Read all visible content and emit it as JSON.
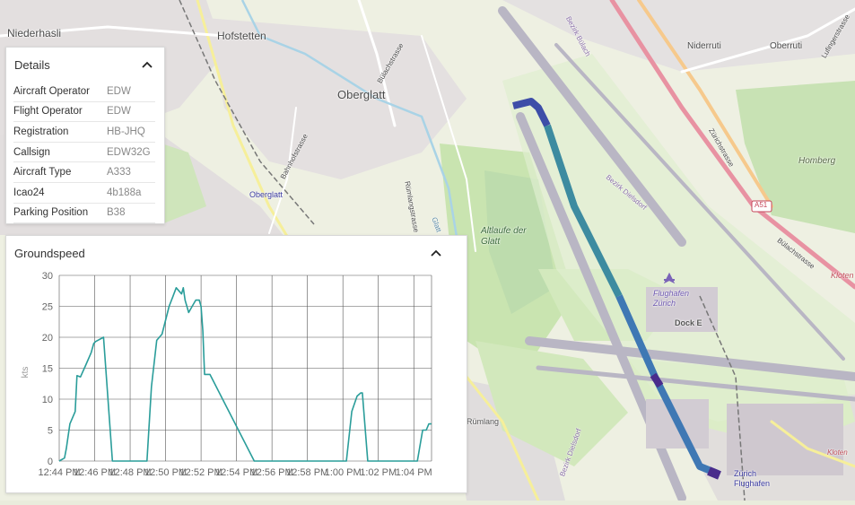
{
  "map": {
    "places": [
      "Niederhasli",
      "Hofstetten",
      "Oberglatt",
      "Niderruti",
      "Oberruti",
      "Homberg",
      "Altlaufe der Glatt",
      "Flughafen Zürich",
      "Dock E",
      "Zürich Flughafen",
      "Kloten",
      "Rümlang",
      "Oberglatt"
    ],
    "streets": [
      "Bülachstrasse",
      "Bahnhofstrasse",
      "Rümlangstrasse",
      "Zürichstrasse",
      "Bülachstrasse",
      "Bezirk Bülach",
      "Bezirk Dielsdorf",
      "Glatt",
      "Lufingerstrasse",
      "Bezirk Dielsdorf",
      "Kloten"
    ],
    "motorway": "A51"
  },
  "details": {
    "title": "Details",
    "rows": [
      {
        "label": "Aircraft Operator",
        "value": "EDW"
      },
      {
        "label": "Flight Operator",
        "value": "EDW"
      },
      {
        "label": "Registration",
        "value": "HB-JHQ"
      },
      {
        "label": "Callsign",
        "value": "EDW32G"
      },
      {
        "label": "Aircraft Type",
        "value": "A333"
      },
      {
        "label": "Icao24",
        "value": "4b188a"
      },
      {
        "label": "Parking Position",
        "value": "B38"
      }
    ]
  },
  "groundspeed": {
    "title": "Groundspeed"
  },
  "chart_data": {
    "type": "line",
    "title": "Groundspeed",
    "xlabel": "",
    "ylabel": "kts",
    "ylim": [
      0,
      30
    ],
    "yticks": [
      0,
      5,
      10,
      15,
      20,
      25,
      30
    ],
    "xlim_minutes": [
      0,
      21
    ],
    "xtick_labels": [
      "12:44 PM",
      "12:46 PM",
      "12:48 PM",
      "12:50 PM",
      "12:52 PM",
      "12:54 PM",
      "12:56 PM",
      "12:58 PM",
      "1:00 PM",
      "1:02 PM",
      "1:04 PM"
    ],
    "grid": true,
    "color": "#2a9d9a",
    "series": [
      {
        "name": "",
        "x_minutes": [
          0.0,
          0.3,
          0.4,
          0.6,
          0.9,
          1.0,
          1.2,
          1.5,
          1.8,
          1.95,
          2.05,
          2.5,
          3.0,
          4.95,
          5.2,
          5.5,
          5.8,
          6.2,
          6.4,
          6.6,
          6.9,
          7.0,
          7.1,
          7.3,
          7.5,
          7.7,
          7.8,
          7.9,
          8.0,
          8.1,
          8.2,
          8.5,
          11.0,
          16.2,
          16.5,
          16.8,
          17.0,
          17.1,
          17.4,
          18.0,
          20.2,
          20.5,
          20.7,
          20.85,
          21.0
        ],
        "y": [
          0,
          0.5,
          2,
          6,
          8,
          13.8,
          13.6,
          15.5,
          17.5,
          19,
          19.3,
          20,
          0,
          0,
          12,
          19.5,
          20.5,
          25,
          26.5,
          28,
          27,
          28,
          26,
          24,
          25,
          26,
          26,
          26,
          25,
          21,
          14,
          14,
          0,
          0,
          8,
          10.5,
          11,
          11,
          0,
          0,
          0,
          5,
          5,
          6,
          6
        ]
      }
    ]
  }
}
